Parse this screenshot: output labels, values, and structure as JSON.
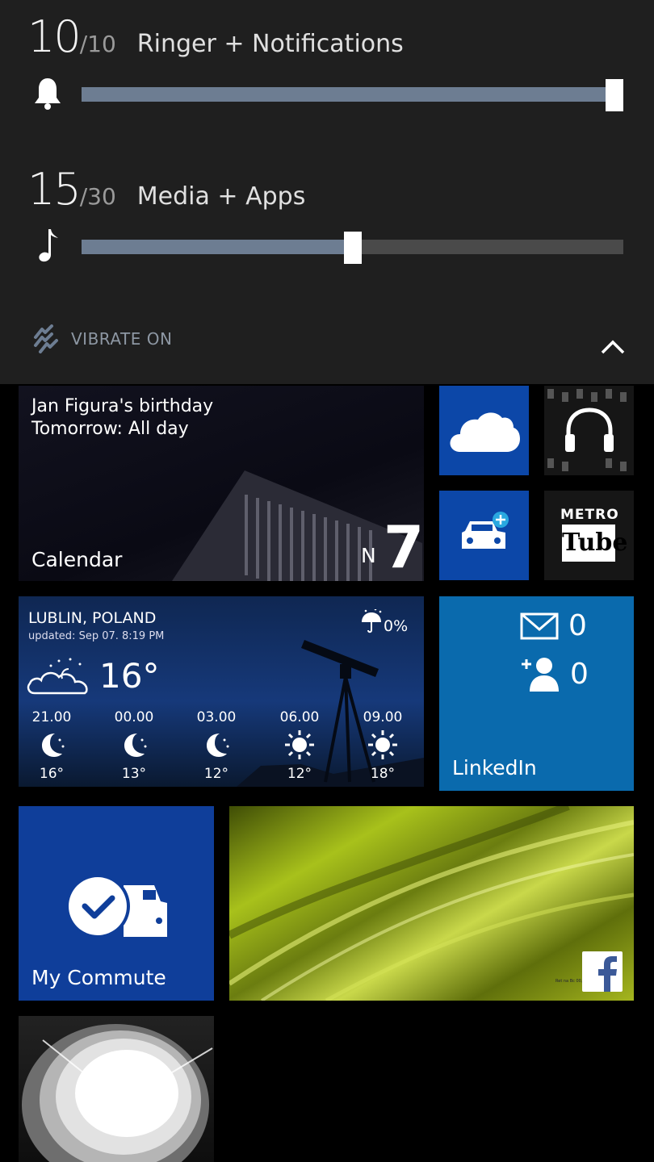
{
  "volume": {
    "ringer": {
      "value": "10",
      "max": "/10",
      "label": "Ringer + Notifications",
      "level": 1.0
    },
    "media": {
      "value": "15",
      "max": "/30",
      "label": "Media + Apps",
      "level": 0.5
    },
    "vibrate_label": "VIBRATE ON",
    "icons": {
      "ringer": "bell-icon",
      "media": "music-note-icon",
      "vibrate": "vibrate-icon",
      "collapse": "chevron-up-icon"
    }
  },
  "tiles": {
    "calendar": {
      "event_title": "Jan Figura's birthday",
      "event_time": "Tomorrow: All day",
      "label": "Calendar",
      "weekday": "N",
      "day": "7"
    },
    "onedrive": {
      "icon": "cloud-icon"
    },
    "music": {
      "icon": "headphones-icon"
    },
    "drive": {
      "icon": "car-plus-icon"
    },
    "metrotube": {
      "top": "METRO",
      "box": "Tube"
    },
    "weather": {
      "city": "LUBLIN, POLAND",
      "updated": "updated: Sep 07. 8:19 PM",
      "temp": "16°",
      "rain": "0%",
      "hours": [
        {
          "time": "21.00",
          "icon": "moon-icon",
          "temp": "16°"
        },
        {
          "time": "00.00",
          "icon": "moon-icon",
          "temp": "13°"
        },
        {
          "time": "03.00",
          "icon": "moon-icon",
          "temp": "12°"
        },
        {
          "time": "06.00",
          "icon": "sun-icon",
          "temp": "12°"
        },
        {
          "time": "09.00",
          "icon": "sun-icon",
          "temp": "18°"
        }
      ]
    },
    "linkedin": {
      "messages": "0",
      "invites": "0",
      "label": "LinkedIn"
    },
    "commute": {
      "label": "My Commute"
    },
    "facebook": {
      "icon": "facebook-icon",
      "small_text": "Ret na Bc 00, P"
    },
    "flashlight": {
      "icon": "flashlight-icon"
    }
  },
  "colors": {
    "panel_bg": "#1f1f1f",
    "slider_fill": "#6d7d92",
    "tile_blue": "#0c47a8",
    "linkedin_blue": "#0a6aad"
  }
}
